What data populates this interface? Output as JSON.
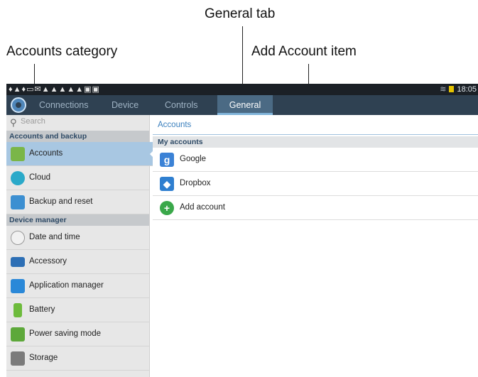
{
  "callouts": {
    "general_tab": "General tab",
    "accounts_category": "Accounts category",
    "add_account_item": "Add Account item"
  },
  "status_bar": {
    "time": "18:05"
  },
  "tabs": [
    {
      "label": "Connections"
    },
    {
      "label": "Device"
    },
    {
      "label": "Controls"
    },
    {
      "label": "General",
      "selected": true
    }
  ],
  "sidebar": {
    "search_placeholder": "Search",
    "sections": [
      {
        "title": "Accounts and backup",
        "items": [
          {
            "label": "Accounts",
            "icon": "key-icon",
            "selected": true
          },
          {
            "label": "Cloud",
            "icon": "cloud-icon"
          },
          {
            "label": "Backup and reset",
            "icon": "backup-reset-icon"
          }
        ]
      },
      {
        "title": "Device manager",
        "items": [
          {
            "label": "Date and time",
            "icon": "clock-icon"
          },
          {
            "label": "Accessory",
            "icon": "accessory-icon"
          },
          {
            "label": "Application manager",
            "icon": "grid-icon"
          },
          {
            "label": "Battery",
            "icon": "battery-icon"
          },
          {
            "label": "Power saving mode",
            "icon": "power-saving-icon"
          },
          {
            "label": "Storage",
            "icon": "storage-icon"
          }
        ]
      }
    ]
  },
  "main": {
    "title": "Accounts",
    "section": "My accounts",
    "accounts": [
      {
        "label": "Google",
        "icon": "google-icon",
        "color": "#3b82d6"
      },
      {
        "label": "Dropbox",
        "icon": "dropbox-icon",
        "color": "#2f7fd0"
      },
      {
        "label": "Add account",
        "icon": "add-icon",
        "color": "#3aa84a"
      }
    ]
  }
}
